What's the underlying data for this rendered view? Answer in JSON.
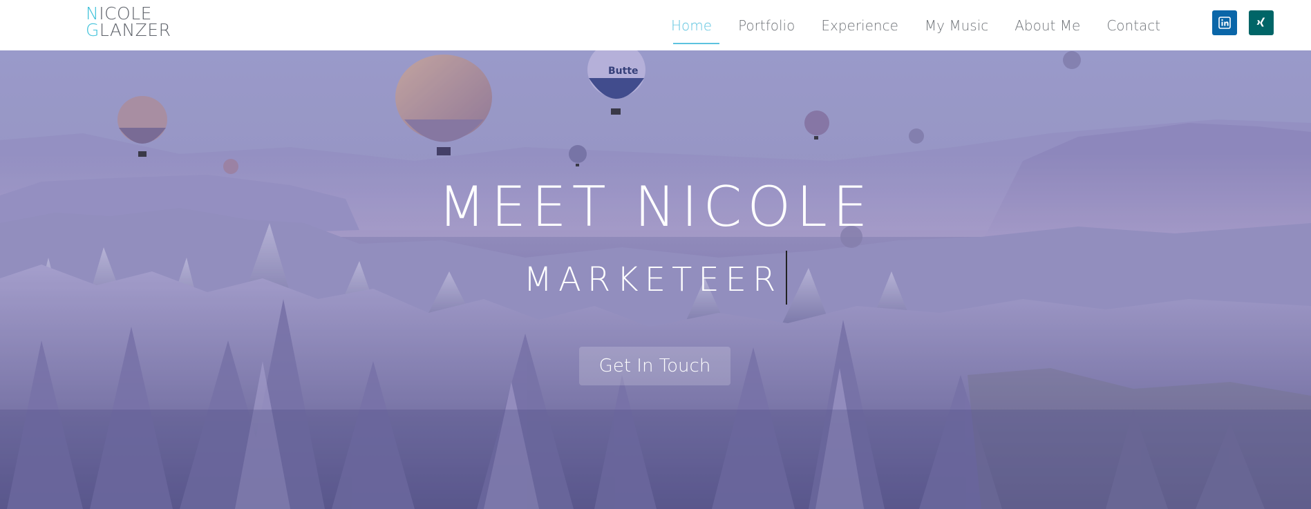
{
  "logo": {
    "line1_initial": "N",
    "line1_rest": "ICOLE",
    "line2_initial": "G",
    "line2_rest": "LANZER"
  },
  "nav": {
    "items": [
      {
        "label": "Home",
        "active": true
      },
      {
        "label": "Portfolio"
      },
      {
        "label": "Experience"
      },
      {
        "label": "My Music"
      },
      {
        "label": "About Me"
      },
      {
        "label": "Contact"
      }
    ]
  },
  "social": [
    {
      "icon": "linkedin-icon",
      "color": "#0a66a8"
    },
    {
      "icon": "xing-icon",
      "color": "#006567"
    }
  ],
  "hero": {
    "title": "MEET NICOLE",
    "subtitle": "MARKETEER",
    "cta_label": "Get In Touch"
  },
  "colors": {
    "accent": "#5cc3df",
    "nav_text": "#6f7378",
    "logo_text": "#5c6068"
  }
}
